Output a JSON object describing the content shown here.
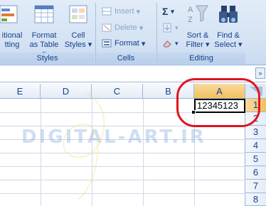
{
  "ribbon": {
    "styles_group": {
      "label": "Styles",
      "conditional_label_1": "itional",
      "conditional_label_2": "tting",
      "format_table_label_1": "Format",
      "format_table_label_2": "as Table",
      "cell_styles_label_1": "Cell",
      "cell_styles_label_2": "Styles"
    },
    "cells_group": {
      "label": "Cells",
      "insert": "Insert",
      "delete": "Delete",
      "format": "Format"
    },
    "editing_group": {
      "label": "Editing",
      "sum_symbol": "Σ",
      "sort_filter_1": "Sort &",
      "sort_filter_2": "Filter",
      "find_select_1": "Find &",
      "find_select_2": "Select"
    }
  },
  "grid": {
    "columns": [
      "E",
      "D",
      "C",
      "B",
      "A"
    ],
    "rows": [
      "1",
      "2",
      "3",
      "4",
      "5",
      "6",
      "7",
      "8"
    ],
    "active_cell_value": "12345123",
    "selected_column": "A",
    "selected_row": "1"
  },
  "watermark": "DIGITAL-ART.IR"
}
